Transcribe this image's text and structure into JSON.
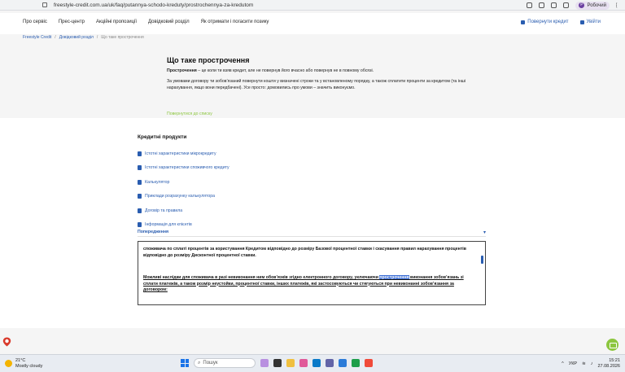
{
  "browser": {
    "url": "freestyle-credit.com.ua/uk/faq/putannya-schodo-kreduty/prostrochennya-za-kredutom",
    "profile_initial": "Р",
    "profile_name": "Робочий"
  },
  "nav": {
    "items": [
      "Про сервіс",
      "Прес-центр",
      "Акційні пропозиції",
      "Довідковий розділ",
      "Як отримати і погасити позику"
    ],
    "repay": "Повернути кредит",
    "login": "Увійти"
  },
  "breadcrumb": [
    "Freestyle Credit",
    "Довідковий розділ",
    "Що таке прострочення"
  ],
  "page": {
    "title": "Що таке прострочення",
    "p1_bold": "Прострочення",
    "p1_rest": " – це коли ти взяв кредит, але не повернув його вчасно або повернув не в повному обсязі.",
    "p2": "За умовами договору ти зобов’язаний повернути кошти у визначені строки та у встановленому порядку, а також сплатити проценти за кредитом (та інші нарахування, якщо вони передбачені). Усе просто: домовились про умови – значить виконуємо.",
    "back": "Повернутися до списку"
  },
  "products": {
    "title": "Кредитні продукти",
    "items": [
      "Істотні характеристики мікрокредиту",
      "Істотні характеристики споживчого кредиту",
      "Калькулятор",
      "Приклади розрахунку калькулятора",
      "Договір та правила",
      "Інформація для клієнтів"
    ]
  },
  "warning": {
    "label": "Попередження",
    "tb_p1": "споживача по сплаті процентів за користування Кредитом відповідно до розміру Базової процентної ставки і скасування правил нарахування процентів відповідно до розміру Дисконтної процентної ставки.",
    "tb_p2_a": "Можливі наслідки для споживача в разі невиконання ним обов’язків згідно електронного договору, уключаючи ",
    "tb_p2_hl": "прострочення",
    "tb_p2_b": " виконання зобов’язань зі сплати платежів, а також розмір неустойки, процентної ставки, інших платежів, які застосовуються чи стягуються при невиконанні зобов’язання за договором:"
  },
  "taskbar": {
    "temp": "21°C",
    "weather": "Mostly cloudy",
    "search": "Пошук",
    "lang": "УКР",
    "time": "15:21",
    "date": "27.08.2026"
  },
  "colors": {
    "link": "#2a5db0",
    "accent_green": "#8cc63f",
    "highlight": "#3d6fd6"
  }
}
